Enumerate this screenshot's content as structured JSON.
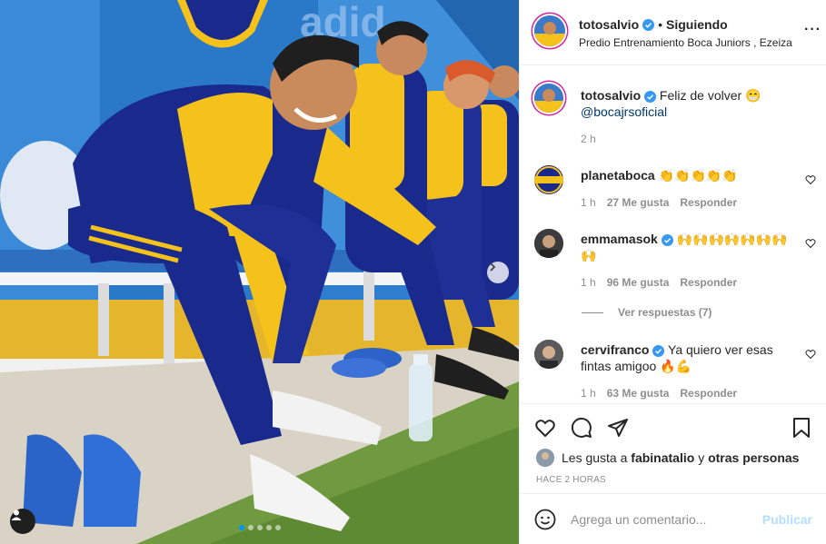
{
  "header": {
    "username": "totosalvio",
    "separator": "•",
    "follow_status": "Siguiendo",
    "location": "Predio Entrenamiento Boca Juniors , Ezeiza",
    "more_label": "···"
  },
  "caption": {
    "username": "totosalvio",
    "text": "Feliz de volver 😁",
    "mention": "@bocajrsoficial",
    "time": "2 h"
  },
  "comments": [
    {
      "username": "planetaboca",
      "text": "👏👏👏👏👏",
      "time": "1 h",
      "likes": "27 Me gusta",
      "reply": "Responder"
    },
    {
      "username": "emmamasok",
      "text": "🙌🙌🙌🙌🙌🙌🙌🙌",
      "time": "1 h",
      "likes": "96 Me gusta",
      "reply": "Responder",
      "view_replies": "Ver respuestas (7)"
    },
    {
      "username": "cervifranco",
      "text": "Ya quiero ver esas fintas amigoo 🔥💪",
      "time": "1 h",
      "likes": "63 Me gusta",
      "reply": "Responder"
    }
  ],
  "likes": {
    "prefix": "Les gusta a",
    "user": "fabinatalio",
    "connector": "y",
    "others": "otras personas"
  },
  "timestamp": "HACE 2 HORAS",
  "add_comment": {
    "placeholder": "Agrega un comentario...",
    "publish_label": "Publicar"
  },
  "colors": {
    "accent": "#0095f6",
    "verified": "#3897f0",
    "publish_disabled": "#b2dffc",
    "boca_blue": "#1a2a8c",
    "boca_yellow": "#f4c21b"
  },
  "carousel": {
    "current": 1,
    "total": 5
  }
}
